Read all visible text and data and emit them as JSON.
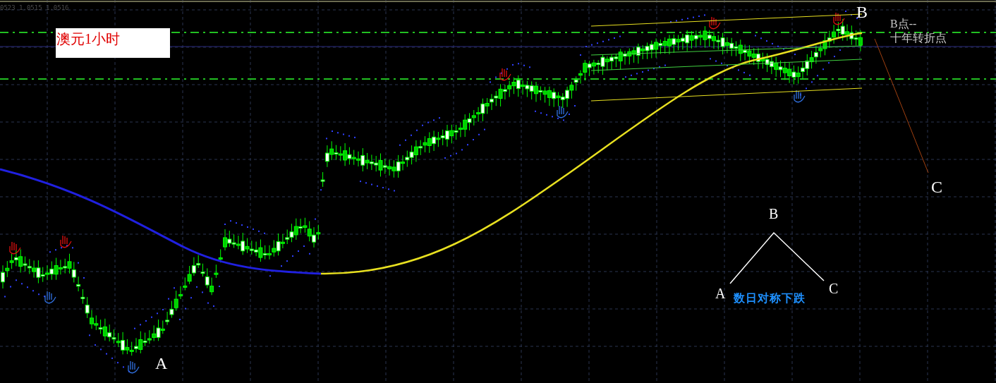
{
  "quote": "0523 1.0515 1.0516",
  "title": "澳元1小时",
  "point_labels": [
    {
      "text": "A"
    },
    {
      "text": "B"
    },
    {
      "text": "C"
    }
  ],
  "note": [
    "B点--",
    "十年转折点"
  ],
  "diagram": {
    "labels": [
      "B",
      "A",
      "C"
    ],
    "caption": "数日对称下跌"
  }
}
